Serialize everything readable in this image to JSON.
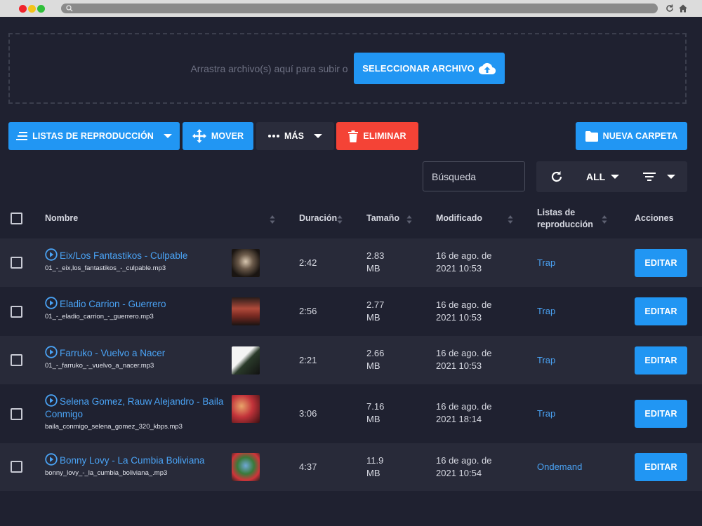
{
  "colors": {
    "accent": "#2196f3",
    "danger": "#f44336",
    "background": "#1f2130",
    "row_alt": "#282a39",
    "link": "#4aa3f5"
  },
  "upload": {
    "drop_text": "Arrastra archivo(s) aquí para subir o",
    "select_label": "SELECCIONAR ARCHIVO",
    "icon": "cloud-upload-icon"
  },
  "toolbar": {
    "playlists_label": "LISTAS DE REPRODUCCIÓN",
    "move_label": "MOVER",
    "more_label": "MÁS",
    "delete_label": "ELIMINAR",
    "new_folder_label": "NUEVA CARPETA"
  },
  "search": {
    "placeholder": "Búsqueda"
  },
  "filter": {
    "all_label": "ALL"
  },
  "table": {
    "columns": {
      "name": "Nombre",
      "duration": "Duración",
      "size": "Tamaño",
      "modified": "Modificado",
      "playlists_line1": "Listas de",
      "playlists_line2": "reproducción",
      "actions": "Acciones"
    },
    "rows": [
      {
        "title": "Eix/Los Fantastikos - Culpable",
        "file": "01_-_eix,los_fantastikos_-_culpable.mp3",
        "duration": "2:42",
        "size_num": "2.83",
        "size_unit": "MB",
        "date_line1": "16 de ago. de",
        "date_line2": "2021 10:53",
        "playlist": "Trap",
        "action": "EDITAR"
      },
      {
        "title": "Eladio Carrion - Guerrero",
        "file": "01_-_eladio_carrion_-_guerrero.mp3",
        "duration": "2:56",
        "size_num": "2.77",
        "size_unit": "MB",
        "date_line1": "16 de ago. de",
        "date_line2": "2021 10:53",
        "playlist": "Trap",
        "action": "EDITAR"
      },
      {
        "title": "Farruko - Vuelvo a Nacer",
        "file": "01_-_farruko_-_vuelvo_a_nacer.mp3",
        "duration": "2:21",
        "size_num": "2.66",
        "size_unit": "MB",
        "date_line1": "16 de ago. de",
        "date_line2": "2021 10:53",
        "playlist": "Trap",
        "action": "EDITAR"
      },
      {
        "title": "Selena Gomez, Rauw Alejandro - Baila Conmigo",
        "file": "baila_conmigo_selena_gomez_320_kbps.mp3",
        "duration": "3:06",
        "size_num": "7.16",
        "size_unit": "MB",
        "date_line1": "16 de ago. de",
        "date_line2": "2021 18:14",
        "playlist": "Trap",
        "action": "EDITAR"
      },
      {
        "title": "Bonny Lovy - La Cumbia Boliviana",
        "file": "bonny_lovy_-_la_cumbia_boliviana_.mp3",
        "duration": "4:37",
        "size_num": "11.9",
        "size_unit": "MB",
        "date_line1": "16 de ago. de",
        "date_line2": "2021 10:54",
        "playlist": "Ondemand",
        "action": "EDITAR"
      }
    ]
  }
}
